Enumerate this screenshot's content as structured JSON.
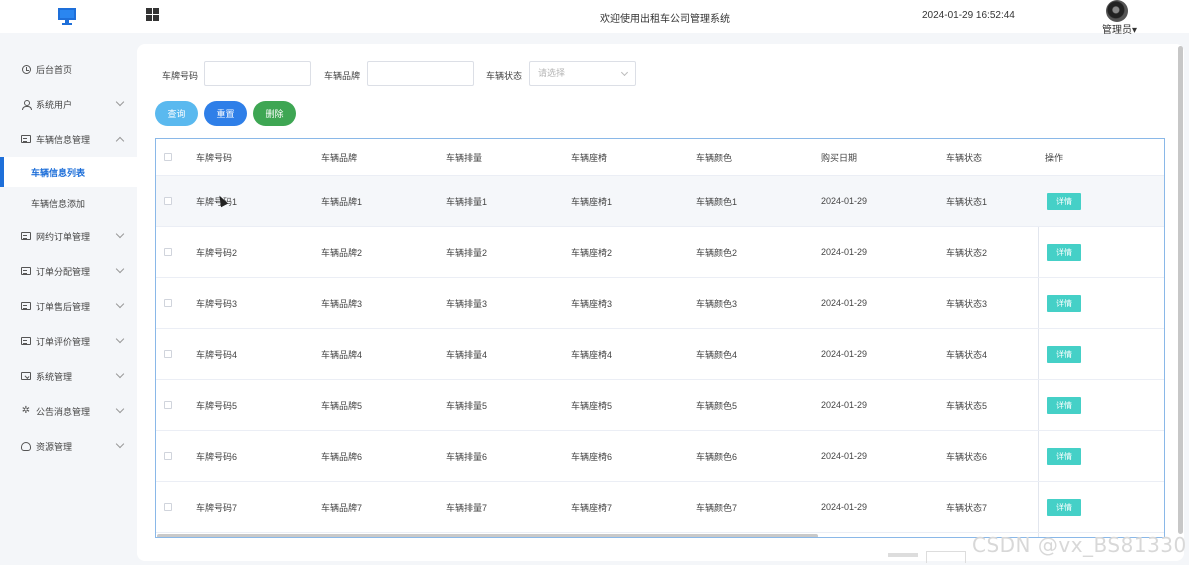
{
  "header": {
    "welcome": "欢迎使用出租车公司管理系统",
    "datetime": "2024-01-29 16:52:44",
    "admin_label": "管理员",
    "admin_caret": "▾"
  },
  "sidebar": {
    "items": [
      {
        "label": "后台首页",
        "icon": "clock-icon"
      },
      {
        "label": "系统用户",
        "icon": "user-icon"
      },
      {
        "label": "车辆信息管理",
        "icon": "card-icon"
      },
      {
        "label": "网约订单管理",
        "icon": "card-icon"
      },
      {
        "label": "订单分配管理",
        "icon": "card-icon"
      },
      {
        "label": "订单售后管理",
        "icon": "card-icon"
      },
      {
        "label": "订单评价管理",
        "icon": "card-icon"
      },
      {
        "label": "系统管理",
        "icon": "folder-icon"
      },
      {
        "label": "公告消息管理",
        "icon": "sun-icon"
      },
      {
        "label": "资源管理",
        "icon": "database-icon"
      }
    ],
    "sub_items": [
      {
        "label": "车辆信息列表",
        "active": true
      },
      {
        "label": "车辆信息添加",
        "active": false
      }
    ]
  },
  "filters": {
    "plate_label": "车牌号码",
    "brand_label": "车辆品牌",
    "status_label": "车辆状态",
    "status_placeholder": "请选择"
  },
  "buttons": {
    "query": "查询",
    "reset": "重置",
    "delete": "删除"
  },
  "table": {
    "columns": [
      "车牌号码",
      "车辆品牌",
      "车辆排量",
      "车辆座椅",
      "车辆颜色",
      "购买日期",
      "车辆状态",
      "操作"
    ],
    "detail_label": "详情",
    "rows": [
      [
        "车牌号码1",
        "车辆品牌1",
        "车辆排量1",
        "车辆座椅1",
        "车辆颜色1",
        "2024-01-29",
        "车辆状态1"
      ],
      [
        "车牌号码2",
        "车辆品牌2",
        "车辆排量2",
        "车辆座椅2",
        "车辆颜色2",
        "2024-01-29",
        "车辆状态2"
      ],
      [
        "车牌号码3",
        "车辆品牌3",
        "车辆排量3",
        "车辆座椅3",
        "车辆颜色3",
        "2024-01-29",
        "车辆状态3"
      ],
      [
        "车牌号码4",
        "车辆品牌4",
        "车辆排量4",
        "车辆座椅4",
        "车辆颜色4",
        "2024-01-29",
        "车辆状态4"
      ],
      [
        "车牌号码5",
        "车辆品牌5",
        "车辆排量5",
        "车辆座椅5",
        "车辆颜色5",
        "2024-01-29",
        "车辆状态5"
      ],
      [
        "车牌号码6",
        "车辆品牌6",
        "车辆排量6",
        "车辆座椅6",
        "车辆颜色6",
        "2024-01-29",
        "车辆状态6"
      ],
      [
        "车牌号码7",
        "车辆品牌7",
        "车辆排量7",
        "车辆座椅7",
        "车辆颜色7",
        "2024-01-29",
        "车辆状态7"
      ]
    ]
  },
  "watermark": "CSDN @vx_BS81330",
  "colors": {
    "accent": "#1e6fd9",
    "query_btn": "#5ab9ef",
    "reset_btn": "#2f7fe8",
    "delete_btn": "#3ea653",
    "detail_btn": "#45d0c7"
  }
}
